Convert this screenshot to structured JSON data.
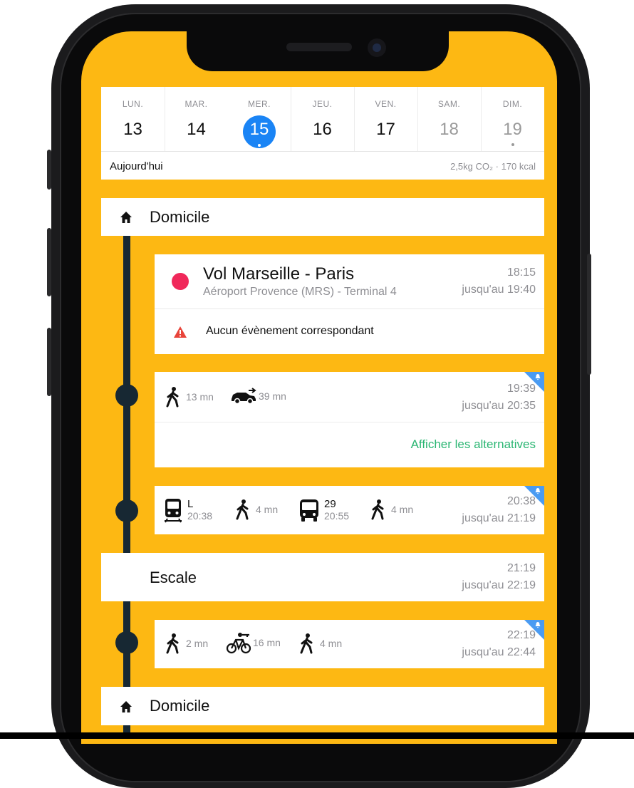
{
  "colors": {
    "background": "#FDB813",
    "accent": "#1a84f5",
    "timeline": "#172833",
    "success": "#2bb673",
    "flight_dot": "#f0285a",
    "warning": "#e8443a",
    "notification": "#4a9bf2"
  },
  "calendar": {
    "days": [
      {
        "name": "LUN.",
        "num": "13"
      },
      {
        "name": "MAR.",
        "num": "14"
      },
      {
        "name": "MER.",
        "num": "15"
      },
      {
        "name": "JEU.",
        "num": "16"
      },
      {
        "name": "VEN.",
        "num": "17"
      },
      {
        "name": "SAM.",
        "num": "18"
      },
      {
        "name": "DIM.",
        "num": "19"
      }
    ],
    "today_label": "Aujourd'hui",
    "stats": "2,5kg CO₂ · 170 kcal"
  },
  "timeline": {
    "start": {
      "label": "Domicile",
      "icon": "home-icon"
    },
    "flight": {
      "title": "Vol Marseille - Paris",
      "subtitle": "Aéroport Provence (MRS) - Terminal 4",
      "time_start": "18:15",
      "time_end": "jusqu'au 19:40",
      "warning": "Aucun évènement correspondant"
    },
    "trip1": {
      "walk": "13 mn",
      "car": "39 mn",
      "time_start": "19:39",
      "time_end": "jusqu'au 20:35",
      "alternatives": "Afficher les alternatives"
    },
    "trip2": {
      "train_line": "L",
      "train_time": "20:38",
      "walk1": "4 mn",
      "bus_line": "29",
      "bus_time": "20:55",
      "walk2": "4 mn",
      "time_start": "20:38",
      "time_end": "jusqu'au 21:19"
    },
    "stop": {
      "label": "Escale",
      "time_start": "21:19",
      "time_end": "jusqu'au 22:19"
    },
    "trip3": {
      "walk1": "2 mn",
      "bike": "16 mn",
      "walk2": "4 mn",
      "time_start": "22:19",
      "time_end": "jusqu'au 22:44"
    },
    "end": {
      "label": "Domicile",
      "icon": "home-icon"
    }
  }
}
